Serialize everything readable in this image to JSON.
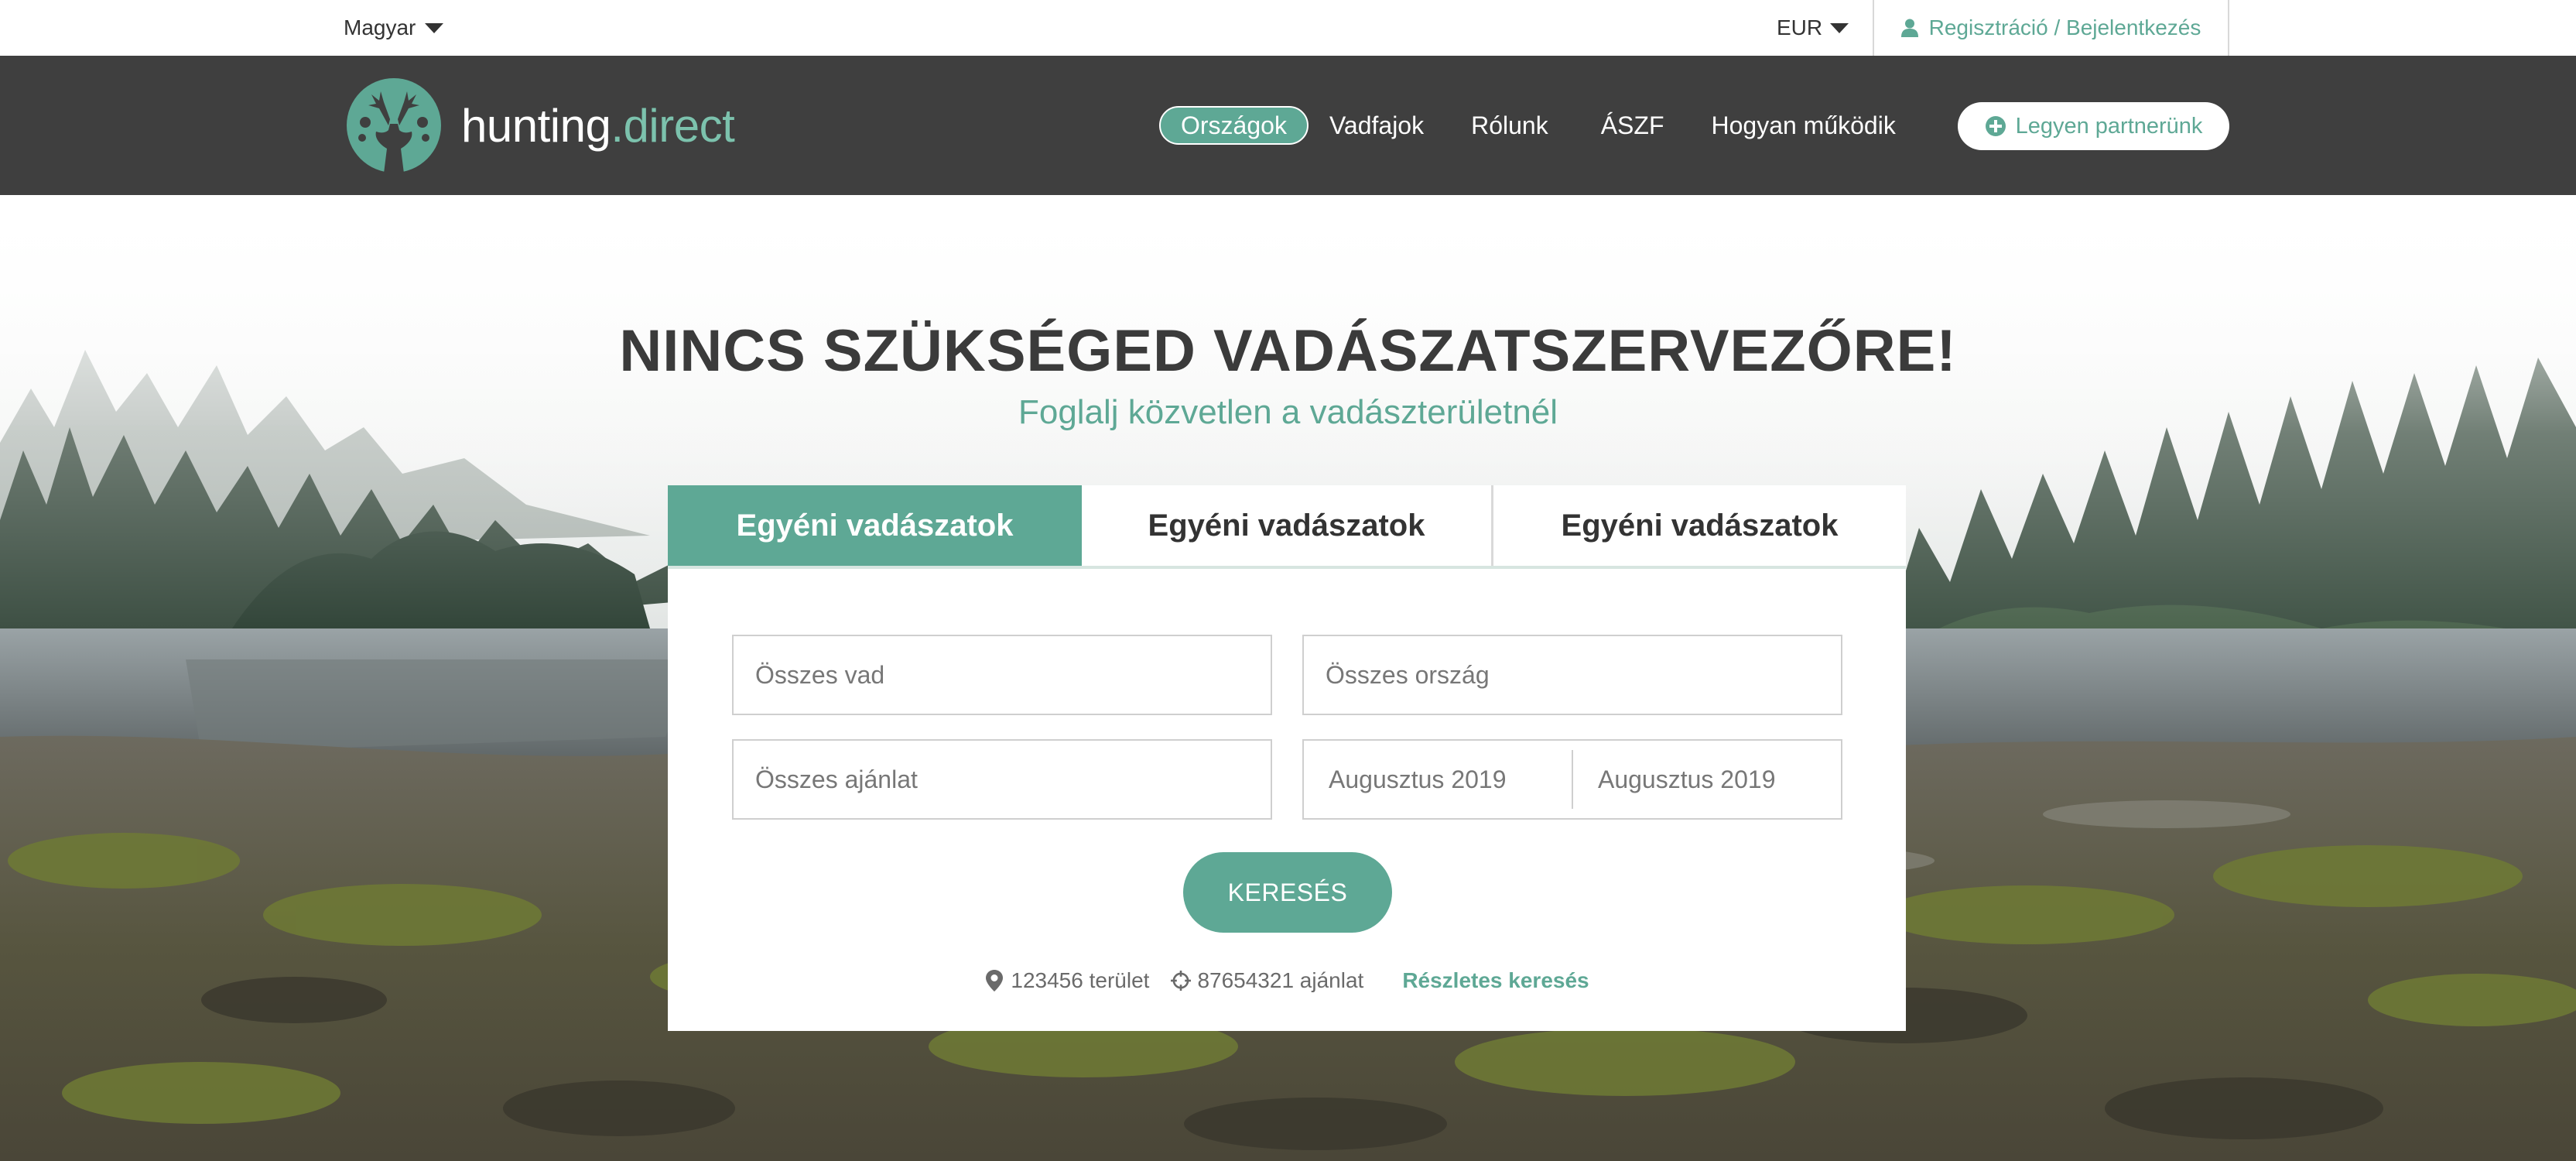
{
  "topbar": {
    "language": "Magyar",
    "currency": "EUR",
    "login_label": "Regisztráció / Bejelentkezés"
  },
  "brand": {
    "name_main": "hunting",
    "name_accent": ".direct",
    "accent_color": "#5ea895",
    "nav_bg": "#3f3f3f"
  },
  "nav": {
    "items": [
      {
        "label": "Országok",
        "active": true
      },
      {
        "label": "Vadfajok",
        "active": false
      },
      {
        "label": "Rólunk",
        "active": false
      },
      {
        "label": "ÁSZF",
        "active": false
      },
      {
        "label": "Hogyan működik",
        "active": false
      }
    ],
    "partner_label": "Legyen partnerünk"
  },
  "hero": {
    "headline": "NINCS SZÜKSÉGED VADÁSZATSZERVEZŐRE!",
    "subline": "Foglalj közvetlen a vadászterületnél"
  },
  "search": {
    "tabs": [
      {
        "label": "Egyéni vadászatok",
        "active": true
      },
      {
        "label": "Egyéni vadászatok",
        "active": false
      },
      {
        "label": "Egyéni vadászatok",
        "active": false
      }
    ],
    "game_placeholder": "Összes vad",
    "country_placeholder": "Összes ország",
    "offer_placeholder": "Összes ajánlat",
    "date_from": "Augusztus 2019",
    "date_to": "Augusztus 2019",
    "button_label": "KERESÉS",
    "stats": {
      "areas": "123456 terület",
      "offers": "87654321 ajánlat"
    },
    "advanced_label": "Részletes keresés"
  }
}
